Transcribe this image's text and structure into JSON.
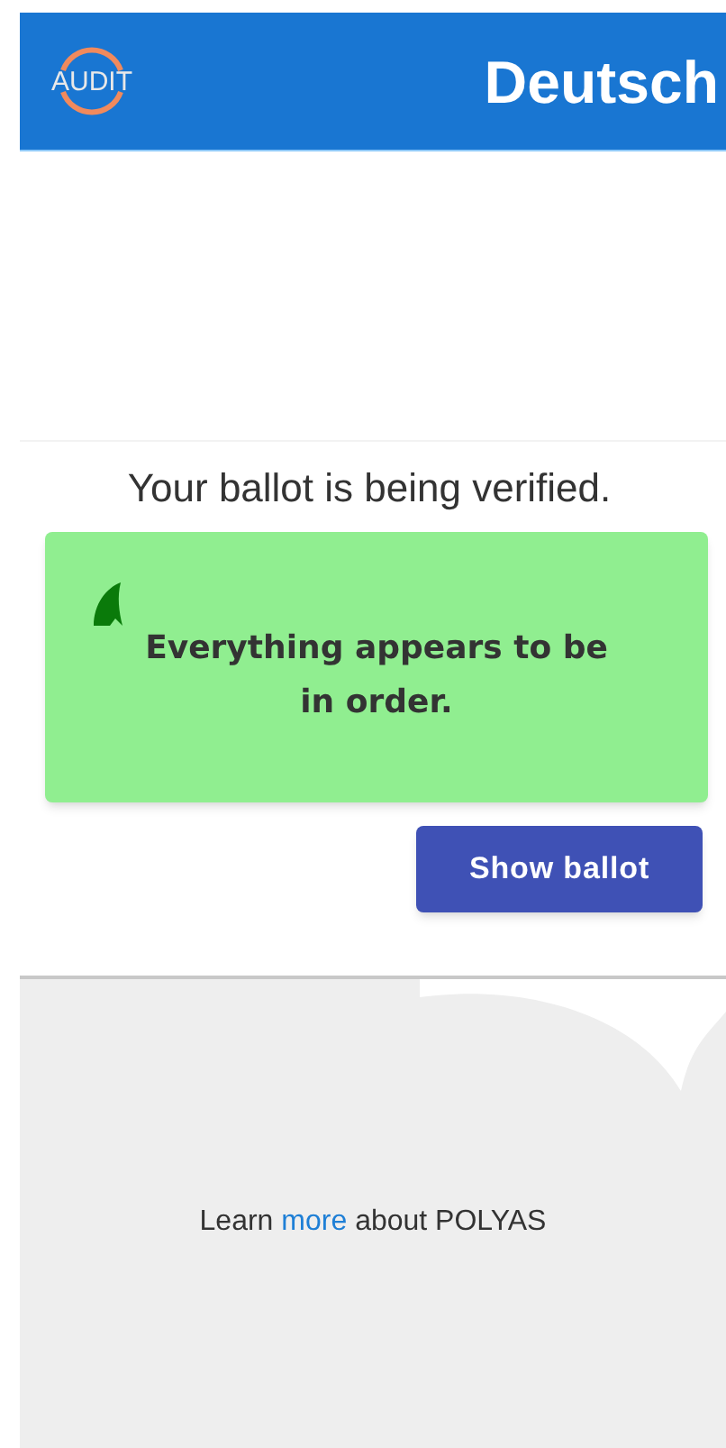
{
  "header": {
    "logo_text": "AUDIT",
    "language": "Deutsch"
  },
  "status": {
    "title": "Your ballot is being verified.",
    "kind": "success",
    "message": "Everything appears to be in order."
  },
  "action": {
    "label": "Show ballot"
  },
  "footer": {
    "before": "Learn",
    "link": "more",
    "after": "about POLYAS"
  }
}
